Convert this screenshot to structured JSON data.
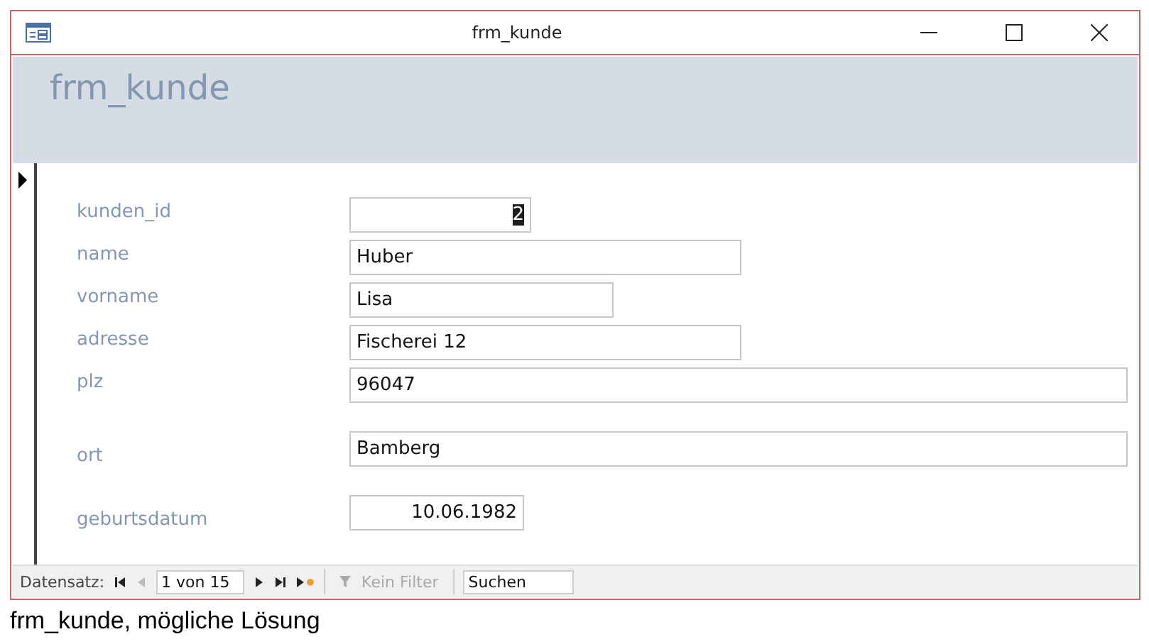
{
  "window": {
    "title": "frm_kunde"
  },
  "form_header": {
    "title": "frm_kunde"
  },
  "fields": [
    {
      "label": "kunden_id",
      "value": "2",
      "kind": "number",
      "highlighted": true,
      "gap_before": false
    },
    {
      "label": "name",
      "value": "Huber",
      "kind": "text",
      "highlighted": false,
      "gap_before": false
    },
    {
      "label": "vorname",
      "value": "Lisa",
      "kind": "short",
      "highlighted": false,
      "gap_before": false
    },
    {
      "label": "adresse",
      "value": "Fischerei 12",
      "kind": "text",
      "highlighted": false,
      "gap_before": false
    },
    {
      "label": "plz",
      "value": "96047",
      "kind": "wide",
      "highlighted": false,
      "gap_before": false
    },
    {
      "label": "ort",
      "value": "Bamberg",
      "kind": "wide",
      "highlighted": false,
      "gap_before": true
    },
    {
      "label": "geburtsdatum",
      "value": "10.06.1982",
      "kind": "date",
      "highlighted": false,
      "gap_before": true
    }
  ],
  "navigation": {
    "label": "Datensatz:",
    "record": "1 von 15",
    "buttons_before": [
      {
        "kind": "first",
        "disabled": false
      },
      {
        "kind": "prev",
        "disabled": true
      }
    ],
    "buttons_after": [
      {
        "kind": "next",
        "disabled": false
      },
      {
        "kind": "last",
        "disabled": false
      },
      {
        "kind": "new",
        "disabled": false
      }
    ],
    "filter": {
      "label": "Kein Filter",
      "disabled": true
    },
    "search": {
      "value": "Suchen"
    }
  },
  "caption": "frm_kunde, mögliche Lösung"
}
